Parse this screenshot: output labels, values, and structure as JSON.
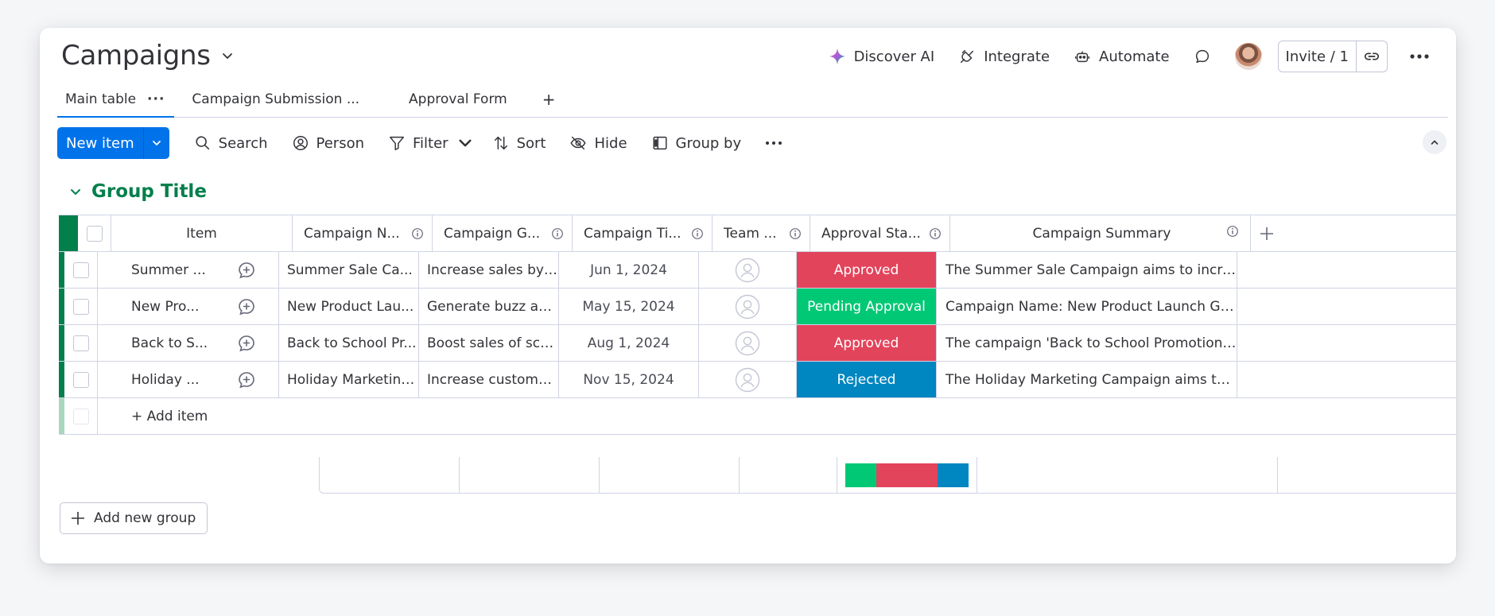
{
  "board": {
    "title": "Campaigns"
  },
  "header": {
    "discover_ai": "Discover AI",
    "integrate": "Integrate",
    "automate": "Automate",
    "invite": "Invite / 1"
  },
  "tabs": [
    {
      "label": "Main table",
      "active": true
    },
    {
      "label": "Campaign Submission ..."
    },
    {
      "label": "Approval Form"
    }
  ],
  "toolbar": {
    "new_item": "New item",
    "search": "Search",
    "person": "Person",
    "filter": "Filter",
    "sort": "Sort",
    "hide": "Hide",
    "group_by": "Group by"
  },
  "group": {
    "title": "Group Title",
    "color": "#037f4c"
  },
  "columns": {
    "item": "Item",
    "name": "Campaign N...",
    "goal": "Campaign G...",
    "time": "Campaign Ti...",
    "team": "Team ...",
    "status": "Approval Sta...",
    "summary": "Campaign Summary"
  },
  "rows": [
    {
      "item": "Summer ...",
      "name": "Summer Sale Ca...",
      "goal": "Increase sales by ...",
      "time": "Jun 1, 2024",
      "status": "Approved",
      "status_color": "#e2445c",
      "summary": "The Summer Sale Campaign aims to increas..."
    },
    {
      "item": "New Pro...",
      "name": "New Product Lau...",
      "goal": "Generate buzz an...",
      "time": "May 15, 2024",
      "status": "Pending Approval",
      "status_color": "#00c875",
      "summary": "Campaign Name: New Product Launch Goal..."
    },
    {
      "item": "Back to S...",
      "name": "Back to School Pr...",
      "goal": "Boost sales of sch...",
      "time": "Aug 1, 2024",
      "status": "Approved",
      "status_color": "#e2445c",
      "summary": "The campaign 'Back to School Promotion' ai..."
    },
    {
      "item": "Holiday ...",
      "name": "Holiday Marketing...",
      "goal": "Increase custome...",
      "time": "Nov 15, 2024",
      "status": "Rejected",
      "status_color": "#0086c0",
      "summary": "The Holiday Marketing Campaign aims to in..."
    }
  ],
  "add_item": "+ Add item",
  "status_summary": [
    {
      "color": "#00c875",
      "share": 0.25
    },
    {
      "color": "#e2445c",
      "share": 0.5
    },
    {
      "color": "#0086c0",
      "share": 0.25
    }
  ],
  "add_group": "Add new group",
  "icons": [
    "chevron-down-icon",
    "sparkle-icon",
    "plug-icon",
    "robot-icon",
    "chat-icon",
    "link-icon",
    "more-icon",
    "search-icon",
    "person-icon",
    "filter-icon",
    "sort-icon",
    "eye-icon",
    "group-icon",
    "info-icon",
    "plus-icon",
    "add-update-icon",
    "person-placeholder-icon",
    "chevron-up-icon"
  ]
}
